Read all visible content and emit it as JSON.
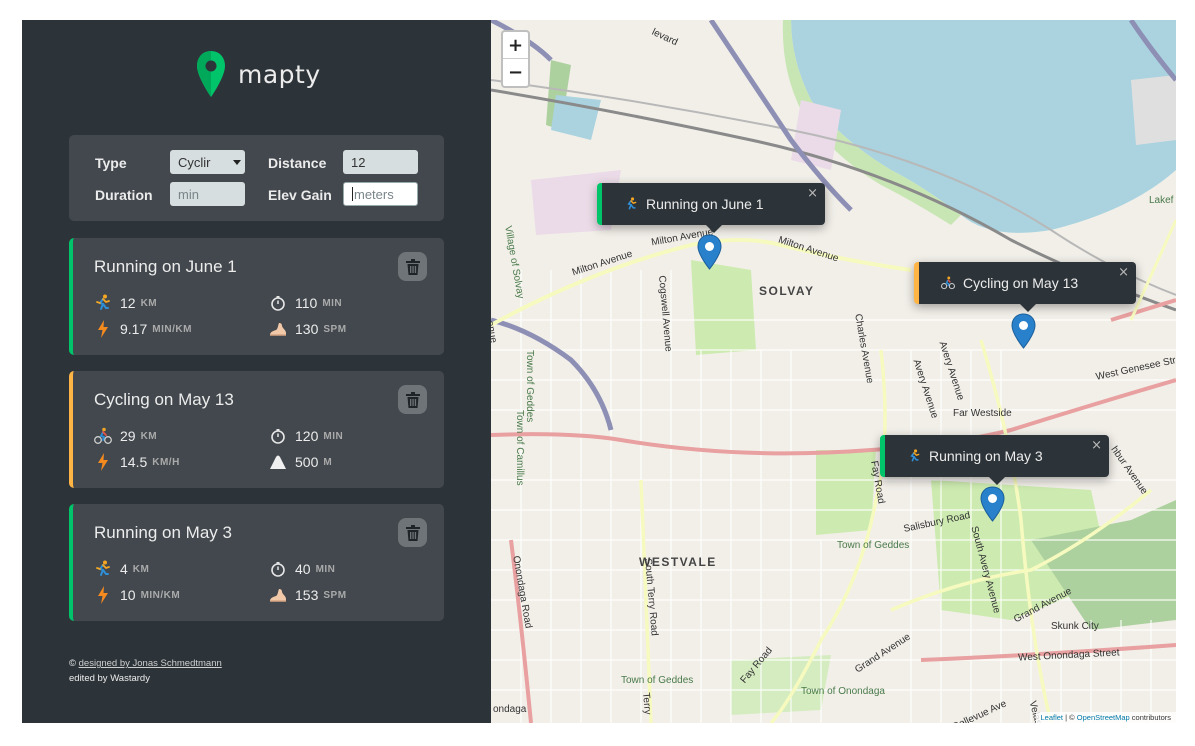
{
  "app": {
    "name": "mapty"
  },
  "form": {
    "type_label": "Type",
    "type_value": "Cyclir",
    "distance_label": "Distance",
    "distance_value": "12",
    "duration_label": "Duration",
    "duration_placeholder": "min",
    "elev_label": "Elev Gain",
    "elev_placeholder": "meters"
  },
  "workouts": [
    {
      "type": "running",
      "title": "Running on June 1",
      "distance": "12",
      "distance_unit": "km",
      "duration": "110",
      "duration_unit": "min",
      "pace": "9.17",
      "pace_unit": "min/km",
      "cadence": "130",
      "cadence_unit": "spm"
    },
    {
      "type": "cycling",
      "title": "Cycling on May 13",
      "distance": "29",
      "distance_unit": "km",
      "duration": "120",
      "duration_unit": "min",
      "speed": "14.5",
      "speed_unit": "km/h",
      "elevation": "500",
      "elevation_unit": "m"
    },
    {
      "type": "running",
      "title": "Running on May 3",
      "distance": "4",
      "distance_unit": "km",
      "duration": "40",
      "duration_unit": "min",
      "pace": "10",
      "pace_unit": "min/km",
      "cadence": "153",
      "cadence_unit": "spm"
    }
  ],
  "footer": {
    "copyright_symbol": "©",
    "designed_by": "designed by Jonas Schmedtmann",
    "edited_by": "edited by Wastardy"
  },
  "map": {
    "zoom_in": "+",
    "zoom_out": "−",
    "popups": [
      {
        "type": "running",
        "text": "Running on June 1"
      },
      {
        "type": "cycling",
        "text": "Cycling on May 13"
      },
      {
        "type": "running",
        "text": "Running on May 3"
      }
    ],
    "popup_close": "×",
    "labels": {
      "solvay": "SOLVAY",
      "westvale": "WESTVALE",
      "milton_avenue_1": "Milton Avenue",
      "milton_avenue_2": "Milton Avenue",
      "milton_avenue_3": "Milton Avenue",
      "village_of_solvay": "Village of Solvay",
      "cogswell_avenue": "Cogswell Avenue",
      "charles_avenue": "Charles Avenue",
      "avery_avenue": "Avery Avenue",
      "far_westside": "Far Westside",
      "west_genesee_street": "West Genesee Street",
      "town_of_geddes_1": "Town of Geddes",
      "town_of_geddes_2": "Town of Geddes",
      "town_of_geddes_3": "Town of Geddes",
      "town_of_camillus": "Town of Camillus",
      "fay_road_1": "Fay Road",
      "fay_road_2": "Fay Road",
      "salisbury_road": "Salisbury Road",
      "south_avery_avenue": "South Avery Avenue",
      "south_terry_road": "South Terry Road",
      "onondaga_road": "Onondaga Road",
      "grand_avenue_1": "Grand Avenue",
      "grand_avenue_2": "Grand Avenue",
      "skunk_city": "Skunk City",
      "west_onondaga_street": "West Onondaga Street",
      "town_of_onondaga": "Town of Onondaga",
      "lakef": "Lakef",
      "hubbur_avenue": "hbur Avenue",
      "evard": "levard",
      "terry": "Terry",
      "bellevue": "Bellevue Ave",
      "velasko": "Velask",
      "ondaga": "ondaga",
      "enue": "enue"
    },
    "attribution_leaflet": "Leaflet",
    "attribution_separator": " | © ",
    "attribution_osm": "OpenStreetMap",
    "attribution_suffix": " contributors"
  },
  "colors": {
    "running": "#00c46a",
    "cycling": "#ffb545",
    "sidebar_bg": "#2d3439",
    "card_bg": "#42484d"
  },
  "icons": {
    "running": "runner-icon",
    "cycling": "cyclist-icon",
    "duration": "stopwatch-icon",
    "pace": "lightning-icon",
    "cadence": "foot-icon",
    "elevation": "mountain-icon",
    "delete": "trash-icon",
    "marker": "map-pin-icon"
  }
}
